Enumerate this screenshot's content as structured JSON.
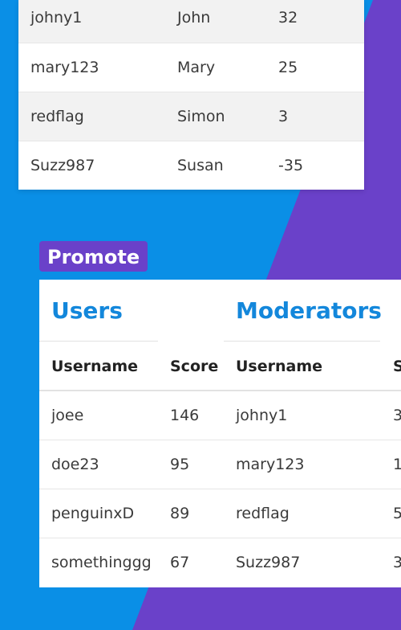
{
  "top_table": {
    "rows": [
      {
        "username": "johny1",
        "name": "John",
        "age": "32"
      },
      {
        "username": "mary123",
        "name": "Mary",
        "age": "25"
      },
      {
        "username": "redflag",
        "name": "Simon",
        "age": "3"
      },
      {
        "username": "Suzz987",
        "name": "Susan",
        "age": "-35"
      }
    ]
  },
  "promote": {
    "label": "Promote"
  },
  "users": {
    "title": "Users",
    "headers": {
      "username": "Username",
      "score": "Score"
    },
    "rows": [
      {
        "username": "joee",
        "score": "146"
      },
      {
        "username": "doe23",
        "score": "95"
      },
      {
        "username": "penguinxD",
        "score": "89"
      },
      {
        "username": "somethinggg",
        "score": "67"
      }
    ]
  },
  "moderators": {
    "title": "Moderators",
    "headers": {
      "username": "Username",
      "score": "S"
    },
    "rows": [
      {
        "username": "johny1",
        "score": "3"
      },
      {
        "username": "mary123",
        "score": "1"
      },
      {
        "username": "redflag",
        "score": "5"
      },
      {
        "username": "Suzz987",
        "score": "3"
      }
    ]
  },
  "colors": {
    "background_blue": "#0a8fe6",
    "background_purple": "#6a41c9",
    "title_blue": "#1387db"
  }
}
